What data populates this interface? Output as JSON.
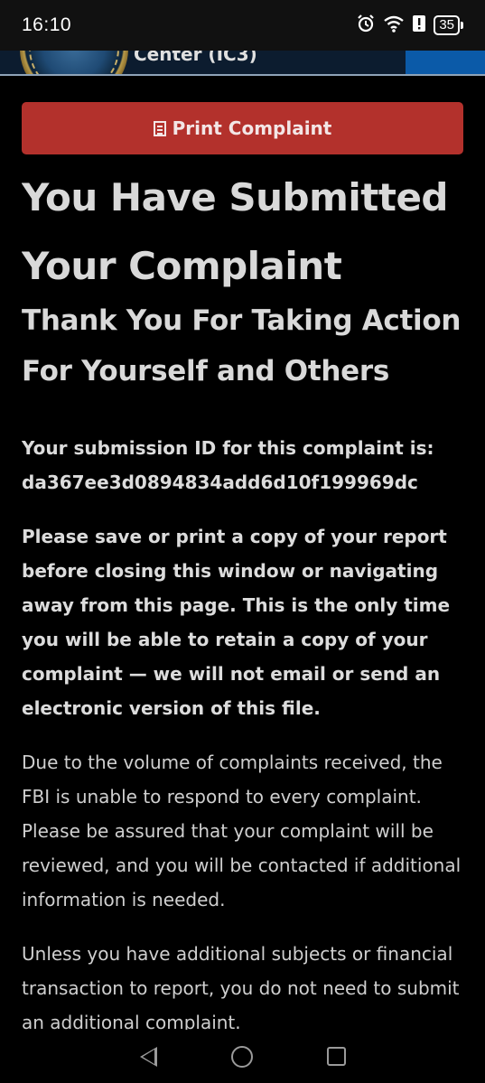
{
  "status_bar": {
    "time": "16:10",
    "icons": [
      "alarm-icon",
      "wifi-icon",
      "alert-icon"
    ],
    "battery": "35"
  },
  "header": {
    "title": "Center (IC3)",
    "seal_name": "internet-crime-complaint-center-seal",
    "colors": {
      "background": "#0c1c2f",
      "accent": "#0b5aa8"
    }
  },
  "print_button": {
    "icon": "print-icon",
    "label": "Print Complaint",
    "color": "#b3312c"
  },
  "heading": "You Have Submitted Your Complaint",
  "subheading": "Thank You For Taking Action For Yourself and Others",
  "submission": {
    "label": "Your submission ID for this complaint is:",
    "id": "da367ee3d0894834add6d10f199969dc"
  },
  "warning": "Please save or print a copy of your report before closing this window or navigating away from this page. This is the only time you will be able to retain a copy of your complaint — we will not email or send an electronic version of this file.",
  "paragraphs": [
    "Due to the volume of complaints received, the FBI is unable to respond to every complaint. Please be assured that your complaint will be reviewed, and you will be contacted if additional information is needed.",
    "Unless you have additional subjects or financial transaction to report, you do not need to submit an additional complaint."
  ],
  "nav_bar": {
    "buttons": [
      "back-icon",
      "home-icon",
      "recents-icon"
    ]
  }
}
